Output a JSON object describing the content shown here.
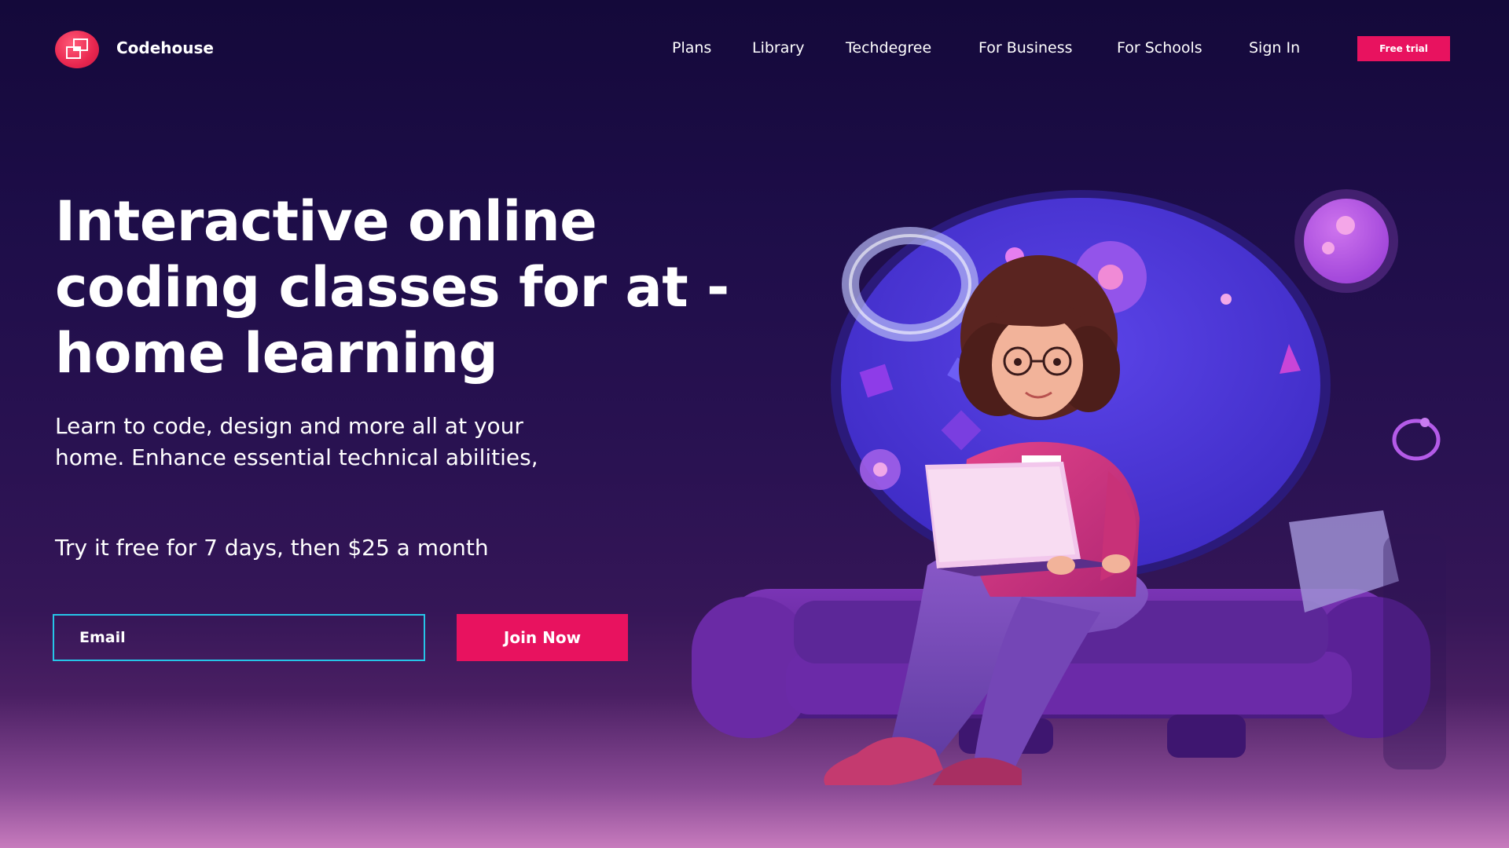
{
  "brand": {
    "name": "Codehouse",
    "accent": "#e8125f"
  },
  "nav": {
    "items": [
      "Plans",
      "Library",
      "Techdegree",
      "For Business",
      "For Schools",
      "Sign In"
    ],
    "cta": "Free trial"
  },
  "hero": {
    "title": "Interactive online coding classes for at - home learning",
    "subtitle": "Learn to code, design and more all at your home. Enhance essential technical abilities,",
    "price_line": "Try it free for 7 days, then $25 a month",
    "email_placeholder": "Email",
    "join_label": "Join Now"
  },
  "colors": {
    "input_border": "#26c5e8",
    "button": "#e8125f"
  },
  "icons": [
    "logo-icon"
  ],
  "illustration": "woman-with-laptop-on-sofa-illustration"
}
